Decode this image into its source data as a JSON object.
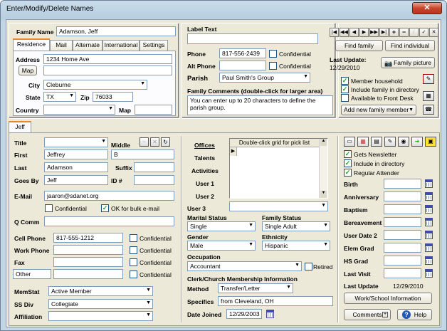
{
  "window": {
    "title": "Enter/Modify/Delete Names",
    "close": "✕"
  },
  "family": {
    "name_label": "Family Name",
    "name_value": "Adamson, Jeff",
    "tabs": [
      "Residence",
      "Mail",
      "Alternate",
      "International",
      "Settings"
    ],
    "address_label": "Address",
    "address_value": "1234 Home Ave",
    "map_button": "Map",
    "city_label": "City",
    "city_value": "Cleburne",
    "state_label": "State",
    "state_value": "TX",
    "zip_label": "Zip",
    "zip_value": "76033",
    "country_label": "Country",
    "map_label": "Map"
  },
  "label_text": {
    "label": "Label Text"
  },
  "phone": {
    "label": "Phone",
    "value": "817-556-2439",
    "alt_label": "Alt Phone",
    "confidential": "Confidential",
    "alt_confidential": "Confidential"
  },
  "parish": {
    "label": "Parish",
    "value": "Paul Smith's Group"
  },
  "family_comments": {
    "label": "Family Comments  (double-click for larger area)",
    "text": "You can enter up to 20 characters to define the parish group."
  },
  "nav": {
    "find_family": "Find family",
    "find_individual": "Find individual",
    "last_update_label": "Last Update:",
    "last_update_value": "12/29/2010",
    "family_picture": "Family picture",
    "member_household": "Member household",
    "include_in_directory": "Include family in directory",
    "available_front_desk": "Available to Front Desk",
    "add_family_member": "Add new family member"
  },
  "person_tab": "Jeff",
  "person": {
    "title_label": "Title",
    "middle_label": "Middle",
    "middle_value": "B",
    "first_label": "First",
    "first_value": "Jeffrey",
    "last_label": "Last",
    "last_value": "Adamson",
    "suffix_label": "Suffix",
    "goesby_label": "Goes By",
    "goesby_value": "Jeff",
    "id_label": "ID #",
    "email_label": "E-Mail",
    "email_value": "jaaron@sdanet.org",
    "email_confidential": "Confidential",
    "email_bulk": "OK for bulk e-mail",
    "qcomm_label": "Q Comm",
    "cell_label": "Cell Phone",
    "cell_value": "817-555-1212",
    "work_label": "Work Phone",
    "fax_label": "Fax",
    "other_label": "Other",
    "confidential": "Confidential",
    "memstat_label": "MemStat",
    "memstat_value": "Active Member",
    "ssdiv_label": "SS Div",
    "ssdiv_value": "Collegiate",
    "affiliation_label": "Affiliation"
  },
  "offices": {
    "offices_label": "Offices",
    "talents_label": "Talents",
    "activities_label": "Activities",
    "user1_label": "User 1",
    "user2_label": "User 2",
    "user3_label": "User 3",
    "grid_header": "Double-click grid for pick list"
  },
  "status": {
    "marital_label": "Marital Status",
    "marital_value": "Single",
    "family_status_label": "Family Status",
    "family_status_value": "Single Adult",
    "gender_label": "Gender",
    "gender_value": "Male",
    "ethnicity_label": "Ethnicity",
    "ethnicity_value": "Hispanic",
    "occupation_label": "Occupation",
    "occupation_value": "Accountant",
    "retired": "Retired",
    "clerk_label": "Clerk/Church Membership Information",
    "method_label": "Method",
    "method_value": "Transfer/Letter",
    "specifics_label": "Specifics",
    "specifics_value": "from Cleveland, OH",
    "date_joined_label": "Date Joined",
    "date_joined_value": "12/29/2003"
  },
  "right": {
    "gets_newsletter": "Gets Newsletter",
    "include_directory": "Include in directory",
    "regular_attender": "Regular Attender",
    "birth": "Birth",
    "anniversary": "Anniversary",
    "baptism": "Baptism",
    "bereavement": "Bereavement",
    "user_date_2": "User Date 2",
    "elem_grad": "Elem Grad",
    "hs_grad": "HS Grad",
    "last_visit": "Last Visit",
    "last_update_label": "Last Update",
    "last_update_value": "12/29/2010",
    "work_school": "Work/School Information",
    "comments": "Comments",
    "help": "Help"
  }
}
